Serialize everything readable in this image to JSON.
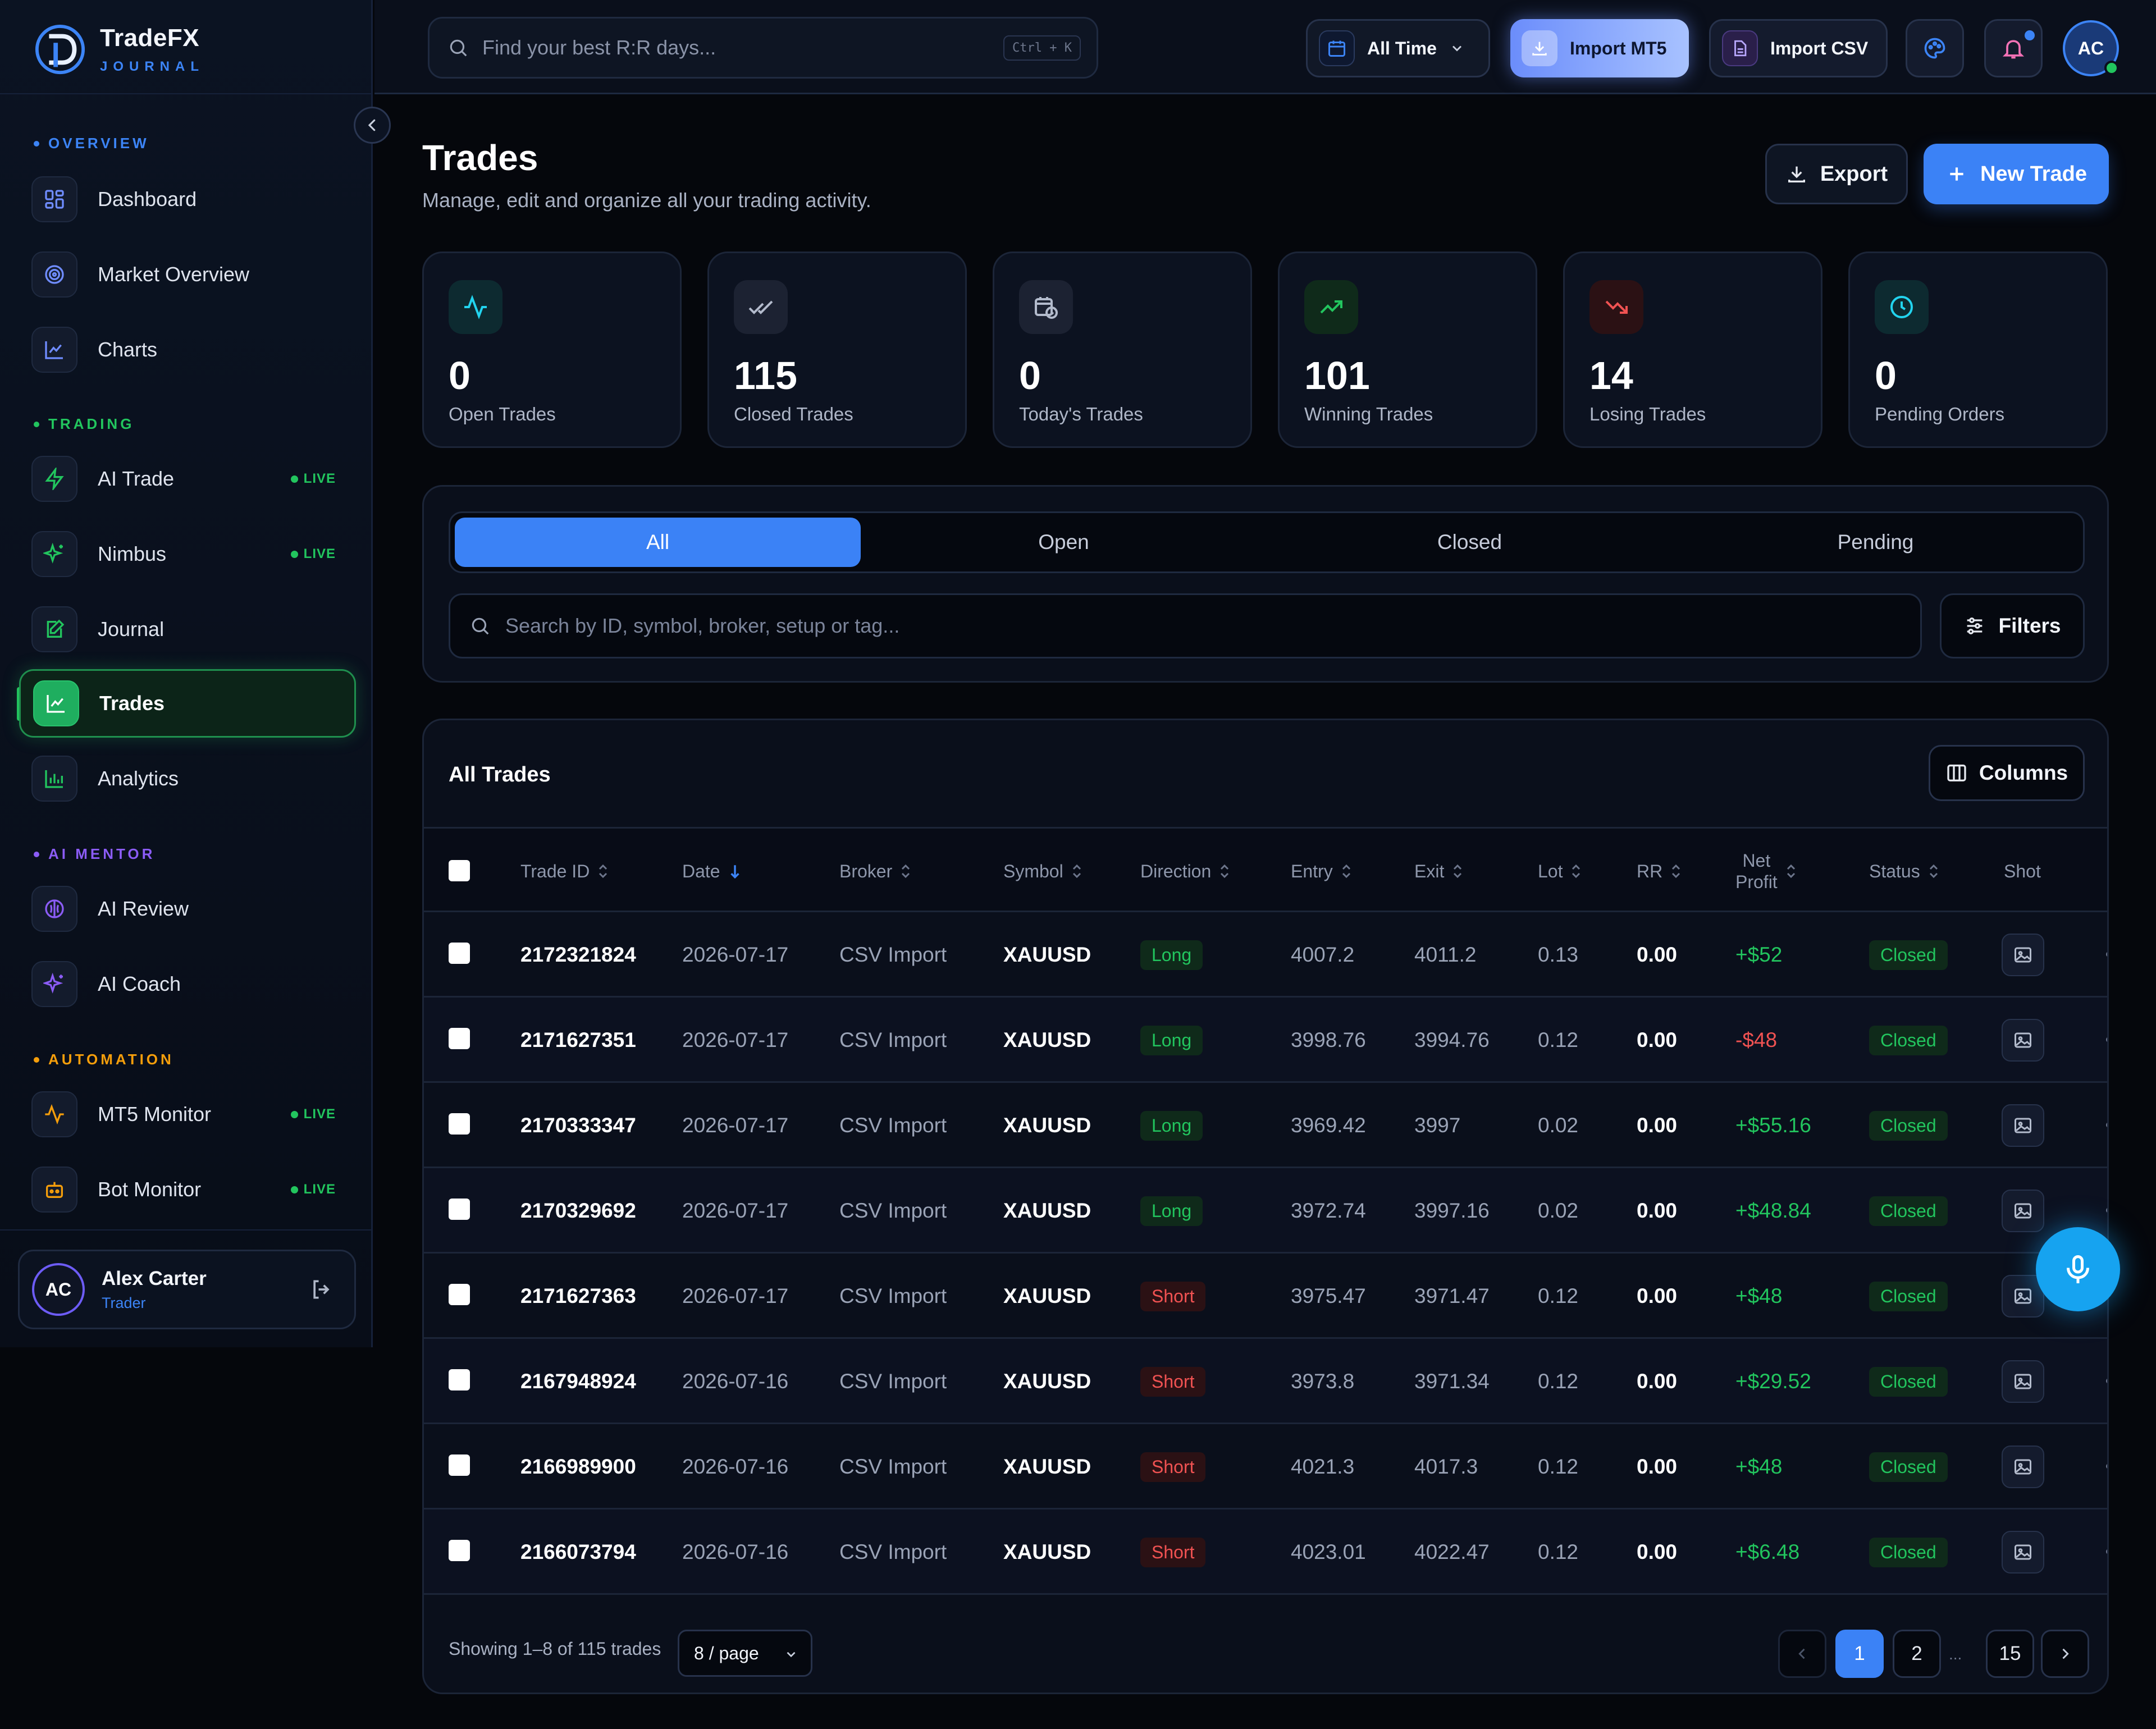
{
  "brand": {
    "title": "TradeFX",
    "subtitle": "JOURNAL"
  },
  "sidebar": {
    "sections": [
      {
        "label": "OVERVIEW",
        "color": "#3c84f6"
      },
      {
        "label": "TRADING",
        "color": "#22c55e"
      },
      {
        "label": "AI MENTOR",
        "color": "#8b5cf6"
      },
      {
        "label": "AUTOMATION",
        "color": "#f59e0b"
      }
    ],
    "items": [
      {
        "label": "Dashboard",
        "icon": "grid-icon"
      },
      {
        "label": "Market Overview",
        "icon": "target-icon"
      },
      {
        "label": "Charts",
        "icon": "chart-icon"
      },
      {
        "label": "AI Trade",
        "icon": "bolt-icon",
        "badge": "LIVE"
      },
      {
        "label": "Nimbus",
        "icon": "sparkles-icon",
        "badge": "LIVE"
      },
      {
        "label": "Journal",
        "icon": "edit-icon"
      },
      {
        "label": "Trades",
        "icon": "trend-chart-icon",
        "active": true
      },
      {
        "label": "Analytics",
        "icon": "bar-chart-icon"
      },
      {
        "label": "AI Review",
        "icon": "brain-icon"
      },
      {
        "label": "AI Coach",
        "icon": "sparkles-icon"
      },
      {
        "label": "MT5 Monitor",
        "icon": "activity-icon",
        "badge": "LIVE"
      },
      {
        "label": "Bot Monitor",
        "icon": "bot-icon",
        "badge": "LIVE"
      }
    ],
    "user": {
      "initials": "AC",
      "name": "Alex Carter",
      "role": "Trader"
    }
  },
  "topbar": {
    "search_placeholder": "Find your best R:R days...",
    "shortcut": "Ctrl + K",
    "range_label": "All Time",
    "import_mt5": "Import MT5",
    "import_csv": "Import CSV",
    "avatar_initials": "AC"
  },
  "page": {
    "title": "Trades",
    "subtitle": "Manage, edit and organize all your trading activity.",
    "export_label": "Export",
    "new_trade_label": "New Trade"
  },
  "stats": [
    {
      "value": "0",
      "label": "Open Trades",
      "icon": "pulse-icon",
      "color": "#22d3ee"
    },
    {
      "value": "115",
      "label": "Closed Trades",
      "icon": "double-check-icon",
      "color": "#9aa3b6"
    },
    {
      "value": "0",
      "label": "Today's Trades",
      "icon": "calendar-clock-icon",
      "color": "#9aa3b6"
    },
    {
      "value": "101",
      "label": "Winning Trades",
      "icon": "trending-up-icon",
      "color": "#22c55e"
    },
    {
      "value": "14",
      "label": "Losing Trades",
      "icon": "trending-down-icon",
      "color": "#f05252"
    },
    {
      "value": "0",
      "label": "Pending Orders",
      "icon": "clock-icon",
      "color": "#22d3ee"
    }
  ],
  "filters": {
    "tabs": [
      "All",
      "Open",
      "Closed",
      "Pending"
    ],
    "active_tab": "All",
    "search_placeholder": "Search by ID, symbol, broker, setup or tag...",
    "filters_label": "Filters"
  },
  "table": {
    "title": "All Trades",
    "columns_label": "Columns",
    "headers": {
      "trade_id": "Trade ID",
      "date": "Date",
      "broker": "Broker",
      "symbol": "Symbol",
      "direction": "Direction",
      "entry": "Entry",
      "exit": "Exit",
      "lot": "Lot",
      "rr": "RR",
      "net_profit_1": "Net",
      "net_profit_2": "Profit",
      "status": "Status",
      "shot": "Shot"
    },
    "rows": [
      {
        "id": "2172321824",
        "date": "2026-07-17",
        "broker": "CSV Import",
        "symbol": "XAUUSD",
        "direction": "Long",
        "entry": "4007.2",
        "exit": "4011.2",
        "lot": "0.13",
        "rr": "0.00",
        "profit": "+$52",
        "status": "Closed"
      },
      {
        "id": "2171627351",
        "date": "2026-07-17",
        "broker": "CSV Import",
        "symbol": "XAUUSD",
        "direction": "Long",
        "entry": "3998.76",
        "exit": "3994.76",
        "lot": "0.12",
        "rr": "0.00",
        "profit": "-$48",
        "status": "Closed"
      },
      {
        "id": "2170333347",
        "date": "2026-07-17",
        "broker": "CSV Import",
        "symbol": "XAUUSD",
        "direction": "Long",
        "entry": "3969.42",
        "exit": "3997",
        "lot": "0.02",
        "rr": "0.00",
        "profit": "+$55.16",
        "status": "Closed"
      },
      {
        "id": "2170329692",
        "date": "2026-07-17",
        "broker": "CSV Import",
        "symbol": "XAUUSD",
        "direction": "Long",
        "entry": "3972.74",
        "exit": "3997.16",
        "lot": "0.02",
        "rr": "0.00",
        "profit": "+$48.84",
        "status": "Closed"
      },
      {
        "id": "2171627363",
        "date": "2026-07-17",
        "broker": "CSV Import",
        "symbol": "XAUUSD",
        "direction": "Short",
        "entry": "3975.47",
        "exit": "3971.47",
        "lot": "0.12",
        "rr": "0.00",
        "profit": "+$48",
        "status": "Closed"
      },
      {
        "id": "2167948924",
        "date": "2026-07-16",
        "broker": "CSV Import",
        "symbol": "XAUUSD",
        "direction": "Short",
        "entry": "3973.8",
        "exit": "3971.34",
        "lot": "0.12",
        "rr": "0.00",
        "profit": "+$29.52",
        "status": "Closed"
      },
      {
        "id": "2166989900",
        "date": "2026-07-16",
        "broker": "CSV Import",
        "symbol": "XAUUSD",
        "direction": "Short",
        "entry": "4021.3",
        "exit": "4017.3",
        "lot": "0.12",
        "rr": "0.00",
        "profit": "+$48",
        "status": "Closed"
      },
      {
        "id": "2166073794",
        "date": "2026-07-16",
        "broker": "CSV Import",
        "symbol": "XAUUSD",
        "direction": "Short",
        "entry": "4023.01",
        "exit": "4022.47",
        "lot": "0.12",
        "rr": "0.00",
        "profit": "+$6.48",
        "status": "Closed"
      }
    ],
    "footer": {
      "showing": "Showing 1–8 of 115 trades",
      "per_page": "8 / page",
      "pages": [
        "1",
        "2",
        "...",
        "15"
      ],
      "current_page": "1"
    }
  },
  "colors": {
    "accent": "#3b82f6",
    "positive": "#22c55e",
    "negative": "#f05252",
    "background": "#05070c"
  }
}
